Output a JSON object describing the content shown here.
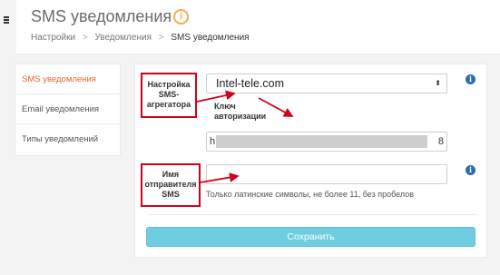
{
  "header": {
    "title": "SMS уведомления",
    "info_icon_glyph": "i",
    "breadcrumb": [
      "Настройки",
      "Уведомления",
      "SMS уведомления"
    ],
    "breadcrumb_sep": ">"
  },
  "sidebar": {
    "items": [
      {
        "label": "SMS уведомления",
        "active": true
      },
      {
        "label": "Email уведомления",
        "active": false
      },
      {
        "label": "Типы уведомлений",
        "active": false
      }
    ]
  },
  "form": {
    "aggregator_label": "Настройка SMS-агрегатора",
    "aggregator_value": "Intel-tele.com",
    "key_label": "Ключ авторизации",
    "key_value_start": "h",
    "key_value_end": "8",
    "sender_label": "Имя отправителя SMS",
    "sender_value": "",
    "sender_help": "Только латинские символы, не более 11, без пробелов",
    "save_label": "Сохранить"
  },
  "icons": {
    "info_blue": "i",
    "caret": "⬍"
  },
  "colors": {
    "accent_orange": "#e8672c",
    "annotation_red": "#d0021b",
    "save_button": "#6fcde0",
    "info_blue": "#2a6bb5"
  }
}
